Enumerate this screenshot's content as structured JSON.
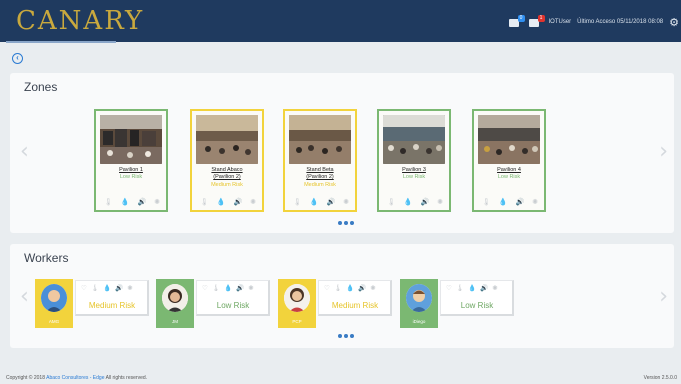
{
  "header": {
    "logo": "CANARY",
    "notif_count": "0",
    "alert_count": "1",
    "user": "IOTUser",
    "last_access": "Último Acceso 05/11/2018 08:08"
  },
  "zones": {
    "title": "Zones",
    "cards": [
      {
        "name_line1": "Pavilion 1",
        "name_line2": "",
        "risk": "Low Risk",
        "level": "low"
      },
      {
        "name_line1": "Stand Abaco",
        "name_line2": "(Pavilion 2)",
        "risk": "Medium Risk",
        "level": "med"
      },
      {
        "name_line1": "Stand Beta",
        "name_line2": "(Pavilion 2)",
        "risk": "Medium Risk",
        "level": "med"
      },
      {
        "name_line1": "Pavilion 3",
        "name_line2": "",
        "risk": "Low Risk",
        "level": "low"
      },
      {
        "name_line1": "Pavilion 4",
        "name_line2": "",
        "risk": "Low Risk",
        "level": "low"
      }
    ]
  },
  "workers": {
    "title": "Workers",
    "cards": [
      {
        "name": "AMG",
        "risk": "Medium Risk",
        "level": "med"
      },
      {
        "name": "JM",
        "risk": "Low Risk",
        "level": "low"
      },
      {
        "name": "PCP",
        "risk": "Medium Risk",
        "level": "med"
      },
      {
        "name": "iDiego",
        "risk": "Low Risk",
        "level": "low"
      }
    ]
  },
  "icons": {
    "back": "back-arrow-icon",
    "sensors": [
      "thermometer-icon",
      "humidity-drop-icon",
      "sound-icon",
      "gas-icon"
    ],
    "heart": "heart-icon",
    "settings": "gear-icon"
  },
  "colors": {
    "header_bg": "#1f3a5f",
    "logo": "#c9a93e",
    "low_risk": "#7bb872",
    "medium_risk": "#f2d33c",
    "accent": "#2b7bd3"
  },
  "footer": {
    "prefix": "Copyright © 2018",
    "company": "Abaco Consultores - Edge",
    "suffix": "All rights reserved.",
    "version": "Version 2.5.0.0"
  }
}
